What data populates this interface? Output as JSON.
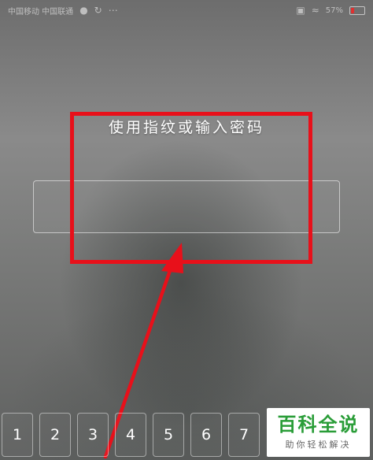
{
  "status_bar": {
    "carrier": "中国移动 中国联通",
    "battery": "57%",
    "icons": [
      "wechat-icon",
      "refresh-icon",
      "more-icon",
      "mute-icon",
      "wifi-icon",
      "battery-icon"
    ]
  },
  "prompt": {
    "text": "使用指纹或输入密码"
  },
  "keypad": {
    "keys": [
      "1",
      "2",
      "3",
      "4",
      "5",
      "6",
      "7"
    ]
  },
  "watermark": {
    "title": "百科全说",
    "subtitle": "助你轻松解决"
  },
  "annotation": {
    "color": "#e8101a"
  }
}
